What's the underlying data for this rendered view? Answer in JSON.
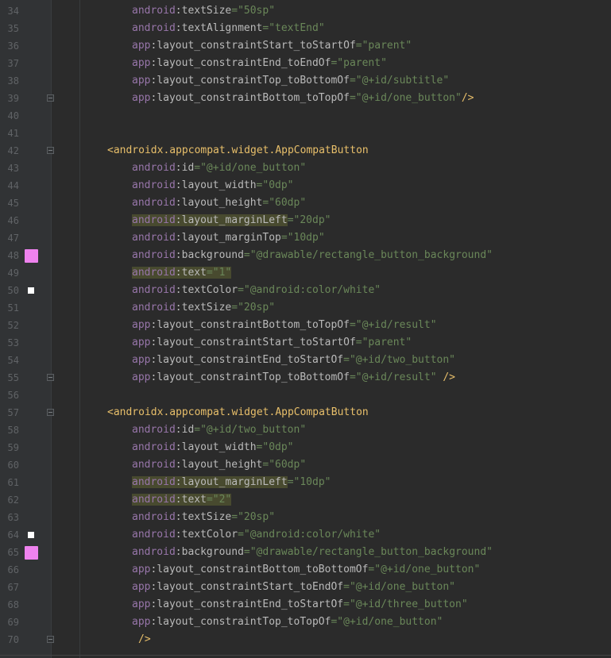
{
  "editor": {
    "colors": {
      "background": "#2b2b2b",
      "gutter": "#313335",
      "namespace": "#9876aa",
      "attribute": "#bababa",
      "string": "#6a8759",
      "tag": "#e8bf6a",
      "highlight": "#3b3a2b",
      "swatch_pink": "#ee82ee",
      "swatch_white": "#ffffff"
    },
    "lines": [
      {
        "num": "34",
        "indent": 2,
        "ns": "android",
        "attr": "textSize",
        "value": "\"50sp\""
      },
      {
        "num": "35",
        "indent": 2,
        "ns": "android",
        "attr": "textAlignment",
        "value": "\"textEnd\""
      },
      {
        "num": "36",
        "indent": 2,
        "ns": "app",
        "attr": "layout_constraintStart_toStartOf",
        "value": "\"parent\""
      },
      {
        "num": "37",
        "indent": 2,
        "ns": "app",
        "attr": "layout_constraintEnd_toEndOf",
        "value": "\"parent\""
      },
      {
        "num": "38",
        "indent": 2,
        "ns": "app",
        "attr": "layout_constraintTop_toBottomOf",
        "value": "\"@+id/subtitle\""
      },
      {
        "num": "39",
        "indent": 2,
        "ns": "app",
        "attr": "layout_constraintBottom_toTopOf",
        "value": "\"@+id/one_button\"",
        "close": "/>",
        "fold": true
      },
      {
        "num": "40"
      },
      {
        "num": "41"
      },
      {
        "num": "42",
        "indent": 1,
        "tag": "<androidx.appcompat.widget.AppCompatButton",
        "fold": true
      },
      {
        "num": "43",
        "indent": 2,
        "ns": "android",
        "attr": "id",
        "value": "\"@+id/one_button\""
      },
      {
        "num": "44",
        "indent": 2,
        "ns": "android",
        "attr": "layout_width",
        "value": "\"0dp\""
      },
      {
        "num": "45",
        "indent": 2,
        "ns": "android",
        "attr": "layout_height",
        "value": "\"60dp\""
      },
      {
        "num": "46",
        "indent": 2,
        "ns": "android",
        "attr": "layout_marginLeft",
        "value": "\"20dp\"",
        "highlight": true
      },
      {
        "num": "47",
        "indent": 2,
        "ns": "android",
        "attr": "layout_marginTop",
        "value": "\"10dp\""
      },
      {
        "num": "48",
        "indent": 2,
        "ns": "android",
        "attr": "background",
        "value": "\"@drawable/rectangle_button_background\"",
        "swatch": "pink"
      },
      {
        "num": "49",
        "indent": 2,
        "ns": "android",
        "attr": "text",
        "value": "\"1\"",
        "highlight_full": true
      },
      {
        "num": "50",
        "indent": 2,
        "ns": "android",
        "attr": "textColor",
        "value": "\"@android:color/white\"",
        "swatch": "white"
      },
      {
        "num": "51",
        "indent": 2,
        "ns": "android",
        "attr": "textSize",
        "value": "\"20sp\""
      },
      {
        "num": "52",
        "indent": 2,
        "ns": "app",
        "attr": "layout_constraintBottom_toTopOf",
        "value": "\"@+id/result\""
      },
      {
        "num": "53",
        "indent": 2,
        "ns": "app",
        "attr": "layout_constraintStart_toStartOf",
        "value": "\"parent\""
      },
      {
        "num": "54",
        "indent": 2,
        "ns": "app",
        "attr": "layout_constraintEnd_toStartOf",
        "value": "\"@+id/two_button\""
      },
      {
        "num": "55",
        "indent": 2,
        "ns": "app",
        "attr": "layout_constraintTop_toBottomOf",
        "value": "\"@+id/result\"",
        "close": " />",
        "fold": true
      },
      {
        "num": "56"
      },
      {
        "num": "57",
        "indent": 1,
        "tag": "<androidx.appcompat.widget.AppCompatButton",
        "fold": true
      },
      {
        "num": "58",
        "indent": 2,
        "ns": "android",
        "attr": "id",
        "value": "\"@+id/two_button\""
      },
      {
        "num": "59",
        "indent": 2,
        "ns": "android",
        "attr": "layout_width",
        "value": "\"0dp\""
      },
      {
        "num": "60",
        "indent": 2,
        "ns": "android",
        "attr": "layout_height",
        "value": "\"60dp\""
      },
      {
        "num": "61",
        "indent": 2,
        "ns": "android",
        "attr": "layout_marginLeft",
        "value": "\"10dp\"",
        "highlight": true
      },
      {
        "num": "62",
        "indent": 2,
        "ns": "android",
        "attr": "text",
        "value": "\"2\"",
        "highlight_full": true
      },
      {
        "num": "63",
        "indent": 2,
        "ns": "android",
        "attr": "textSize",
        "value": "\"20sp\""
      },
      {
        "num": "64",
        "indent": 2,
        "ns": "android",
        "attr": "textColor",
        "value": "\"@android:color/white\"",
        "swatch": "white"
      },
      {
        "num": "65",
        "indent": 2,
        "ns": "android",
        "attr": "background",
        "value": "\"@drawable/rectangle_button_background\"",
        "swatch": "pink"
      },
      {
        "num": "66",
        "indent": 2,
        "ns": "app",
        "attr": "layout_constraintBottom_toBottomOf",
        "value": "\"@+id/one_button\""
      },
      {
        "num": "67",
        "indent": 2,
        "ns": "app",
        "attr": "layout_constraintStart_toEndOf",
        "value": "\"@+id/one_button\""
      },
      {
        "num": "68",
        "indent": 2,
        "ns": "app",
        "attr": "layout_constraintEnd_toStartOf",
        "value": "\"@+id/three_button\""
      },
      {
        "num": "69",
        "indent": 2,
        "ns": "app",
        "attr": "layout_constraintTop_toTopOf",
        "value": "\"@+id/one_button\""
      },
      {
        "num": "70",
        "indent": 3,
        "close_only": "/>",
        "fold": true
      }
    ]
  }
}
